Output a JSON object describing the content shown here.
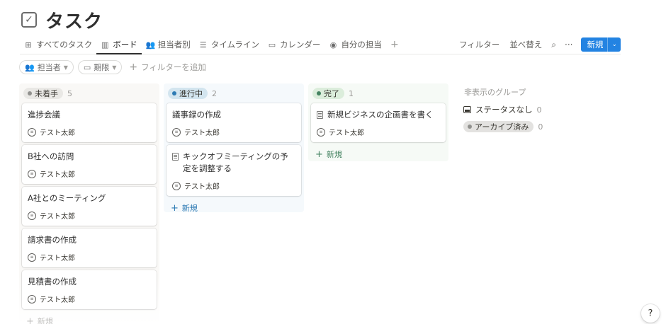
{
  "page": {
    "title": "タスク",
    "icon": "checkbox-icon"
  },
  "tabs": [
    {
      "label": "すべてのタスク",
      "icon": "table-icon",
      "glyph": "⊞",
      "active": false
    },
    {
      "label": "ボード",
      "icon": "board-icon",
      "glyph": "▥",
      "active": true
    },
    {
      "label": "担当者別",
      "icon": "people-icon",
      "glyph": "👥",
      "active": false
    },
    {
      "label": "タイムライン",
      "icon": "timeline-icon",
      "glyph": "☰",
      "active": false
    },
    {
      "label": "カレンダー",
      "icon": "calendar-icon",
      "glyph": "▭",
      "active": false
    },
    {
      "label": "自分の担当",
      "icon": "person-icon",
      "glyph": "◉",
      "active": false
    }
  ],
  "toolbar": {
    "add_view": "+",
    "filter_label": "フィルター",
    "sort_label": "並べ替え",
    "search_glyph": "⌕",
    "more_glyph": "···",
    "new_label": "新規",
    "new_caret": "⌄"
  },
  "filters": {
    "assignee_label": "担当者",
    "due_label": "期限",
    "add_filter_label": "フィルターを追加",
    "plus": "+"
  },
  "board": {
    "new_label": "新規",
    "columns": [
      {
        "status": "未着手",
        "count": "5",
        "pill_color": "#e9e8e5",
        "dot_color": "#91918e",
        "cards": [
          {
            "title": "進捗会議",
            "assignee": "テスト太郎",
            "has_doc_icon": false
          },
          {
            "title": "B社への訪問",
            "assignee": "テスト太郎",
            "has_doc_icon": false
          },
          {
            "title": "A社とのミーティング",
            "assignee": "テスト太郎",
            "has_doc_icon": false
          },
          {
            "title": "請求書の作成",
            "assignee": "テスト太郎",
            "has_doc_icon": false
          },
          {
            "title": "見積書の作成",
            "assignee": "テスト太郎",
            "has_doc_icon": false
          }
        ]
      },
      {
        "status": "進行中",
        "count": "2",
        "pill_color": "#d3e5ef",
        "dot_color": "#2e7bb4",
        "cards": [
          {
            "title": "議事録の作成",
            "assignee": "テスト太郎",
            "has_doc_icon": false
          },
          {
            "title": "キックオフミーティングの予定を調整する",
            "assignee": "テスト太郎",
            "has_doc_icon": true
          }
        ]
      },
      {
        "status": "完了",
        "count": "1",
        "pill_color": "#dbeddb",
        "dot_color": "#448361",
        "cards": [
          {
            "title": "新規ビジネスの企画書を書く",
            "assignee": "テスト太郎",
            "has_doc_icon": true
          }
        ]
      }
    ]
  },
  "hidden_groups": {
    "title": "非表示のグループ",
    "items": [
      {
        "label": "ステータスなし",
        "count": "0",
        "icon": "inbox-icon"
      },
      {
        "label": "アーカイブ済み",
        "count": "0",
        "icon": "status-dot"
      }
    ]
  },
  "help": {
    "glyph": "?"
  }
}
